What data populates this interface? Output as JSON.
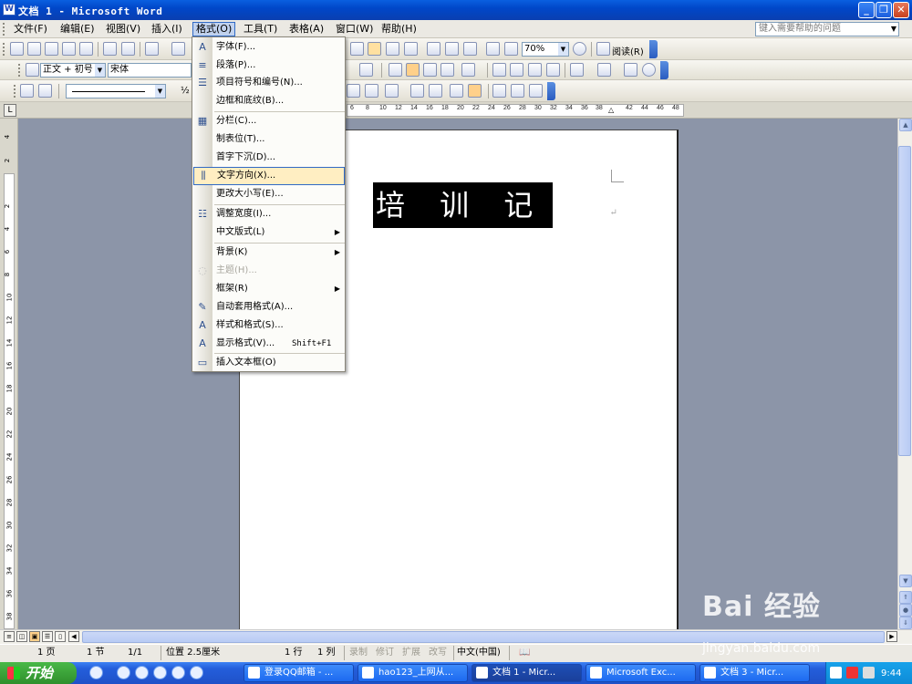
{
  "window": {
    "title": "文档 1 - Microsoft Word",
    "app_icon": "W"
  },
  "menubar": {
    "items": [
      "文件(F)",
      "编辑(E)",
      "视图(V)",
      "插入(I)",
      "格式(O)",
      "工具(T)",
      "表格(A)",
      "窗口(W)",
      "帮助(H)"
    ],
    "active": "格式(O)",
    "help_placeholder": "键入需要帮助的问题"
  },
  "toolbar": {
    "zoom": "70%",
    "read_label": "阅读(R)",
    "style": "正文 + 初号",
    "font": "宋体",
    "fraction_label": "½"
  },
  "ruler": {
    "numbers": [
      "6",
      "8",
      "10",
      "12",
      "14",
      "16",
      "18",
      "20",
      "22",
      "24",
      "26",
      "28",
      "30",
      "32",
      "34",
      "36",
      "38",
      "42",
      "44",
      "46",
      "48"
    ]
  },
  "vruler": {
    "numbers": [
      "4",
      "2",
      "2",
      "4",
      "6",
      "8",
      "10",
      "12",
      "14",
      "16",
      "18",
      "20",
      "22",
      "24",
      "26",
      "28",
      "30",
      "32",
      "34",
      "36",
      "38"
    ]
  },
  "document": {
    "title_text": "培 训 记 录",
    "para_mark": "↵"
  },
  "format_menu": {
    "items": [
      {
        "label": "字体(F)...",
        "icon": "A"
      },
      {
        "label": "段落(P)...",
        "icon": "≡"
      },
      {
        "label": "项目符号和编号(N)...",
        "icon": "☰"
      },
      {
        "label": "边框和底纹(B)...",
        "icon": ""
      },
      {
        "label": "分栏(C)...",
        "icon": "▦"
      },
      {
        "label": "制表位(T)...",
        "icon": ""
      },
      {
        "label": "首字下沉(D)...",
        "icon": ""
      },
      {
        "label": "文字方向(X)...",
        "icon": "⫼"
      },
      {
        "label": "更改大小写(E)...",
        "icon": ""
      },
      {
        "label": "调整宽度(I)...",
        "icon": "☷"
      },
      {
        "label": "中文版式(L)",
        "icon": ""
      },
      {
        "label": "背景(K)",
        "icon": ""
      },
      {
        "label": "主题(H)...",
        "icon": "◌"
      },
      {
        "label": "框架(R)",
        "icon": ""
      },
      {
        "label": "自动套用格式(A)...",
        "icon": "✎"
      },
      {
        "label": "样式和格式(S)...",
        "icon": "A"
      },
      {
        "label": "显示格式(V)...",
        "icon": "A"
      },
      {
        "label": "插入文本框(O)",
        "icon": "▭"
      }
    ],
    "shortcut_show_format": "Shift+F1",
    "submenu_arrow": "▶"
  },
  "statusbar": {
    "page": "1 页",
    "section": "1 节",
    "page_of": "1/1",
    "position": "位置 2.5厘米",
    "line": "1 行",
    "column": "1 列",
    "rec": "录制",
    "trk": "修订",
    "ext": "扩展",
    "ovr": "改写",
    "lang": "中文(中国)"
  },
  "taskbar": {
    "start": "开始",
    "tasks": [
      "登录QQ邮箱 - ...",
      "hao123_上网从...",
      "文档 1 - Micr...",
      "Microsoft Exc...",
      "文档 3 - Micr..."
    ],
    "active_task": "文档 1 - Micr...",
    "clock": "9:44"
  },
  "watermark": {
    "brand": "Bai 经验",
    "url": "jingyan.baidu.com"
  },
  "colors": {
    "menu_highlight": "#ffeec2",
    "title_bar": "#0a5fe0",
    "taskbar": "#245edb",
    "start_green": "#3c9f3a"
  }
}
